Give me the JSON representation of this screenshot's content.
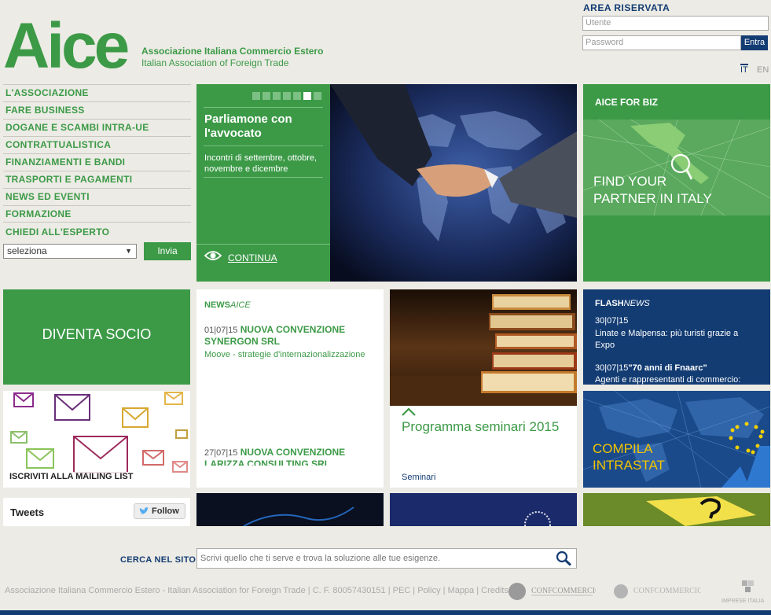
{
  "header": {
    "logo_text": "Aice",
    "assoc_it": "Associazione Italiana Commercio Estero",
    "assoc_en": "Italian Association of Foreign Trade"
  },
  "login": {
    "title": "AREA RISERVATA",
    "user_placeholder": "Utente",
    "pass_placeholder": "Password",
    "submit": "Entra"
  },
  "languages": [
    "IT",
    "EN"
  ],
  "menu": {
    "items": [
      {
        "label": "L'ASSOCIAZIONE"
      },
      {
        "label": "FARE BUSINESS"
      },
      {
        "label": "DOGANE E SCAMBI INTRA-UE"
      },
      {
        "label": "CONTRATTUALISTICA"
      },
      {
        "label": "FINANZIAMENTI E BANDI"
      },
      {
        "label": "TRASPORTI E PAGAMENTI"
      },
      {
        "label": "NEWS ED EVENTI"
      },
      {
        "label": "FORMAZIONE"
      },
      {
        "label": "CHIEDI ALL'ESPERTO"
      }
    ],
    "select_value": "seleziona",
    "submit": "Invia"
  },
  "hero": {
    "title": "Parliamone con l'avvocato",
    "subtitle": "Incontri di settembre, ottobre, novembre e dicembre",
    "continue": "CONTINUA",
    "slide_count": 7,
    "active_slide": 6
  },
  "biz": {
    "title": "AICE FOR BIZ",
    "text_line1": "FIND YOUR",
    "text_line2": "PARTNER IN ITALY"
  },
  "socio": {
    "label": "DIVENTA SOCIO"
  },
  "mailing": {
    "label": "ISCRIVITI ALLA MAILING LIST"
  },
  "tweets": {
    "title": "Tweets",
    "follow": "Follow"
  },
  "news": {
    "title_bold": "NEWS",
    "title_italic": "AICE",
    "items": [
      {
        "date": "01|07|15",
        "title": "NUOVA CONVENZIONE SYNERGON SRL",
        "sub": "Moove - strategie d'internazionalizzazione"
      },
      {
        "date": "27|07|15",
        "title": "NUOVA CONVENZIONE LARIZZA CONSULTING SRL"
      }
    ]
  },
  "seminari": {
    "title": "Programma seminari 2015",
    "tag": "Seminari"
  },
  "flash": {
    "title_bold": "FLASH",
    "title_italic": "NEWS",
    "items": [
      {
        "date": "30|07|15",
        "text": "Linate e Malpensa: più turisti grazie a Expo"
      },
      {
        "date": "30|07|15",
        "title": "\"70 anni di Fnaarc\"",
        "text": "Agenti e rappresentanti di commercio:"
      }
    ]
  },
  "intrastat": {
    "line1": "COMPILA",
    "line2": "INTRASTAT"
  },
  "search": {
    "label": "CERCA NEL SITO",
    "placeholder": "Scrivi quello che ti serve e trova la soluzione alle tue esigenze."
  },
  "footer": {
    "text": "Associazione Italiana Commercio Estero - Italian Association for Foreign Trade | C. F. 80057430151 | PEC | Policy | Mappa | Credits",
    "partners": [
      "CONFCOMMERCIO",
      "CONFCOMMERCIO",
      "IMPRESE ITALIA"
    ]
  },
  "colors": {
    "green": "#3c9a47",
    "navy": "#133c73",
    "background": "#ecebe5"
  }
}
